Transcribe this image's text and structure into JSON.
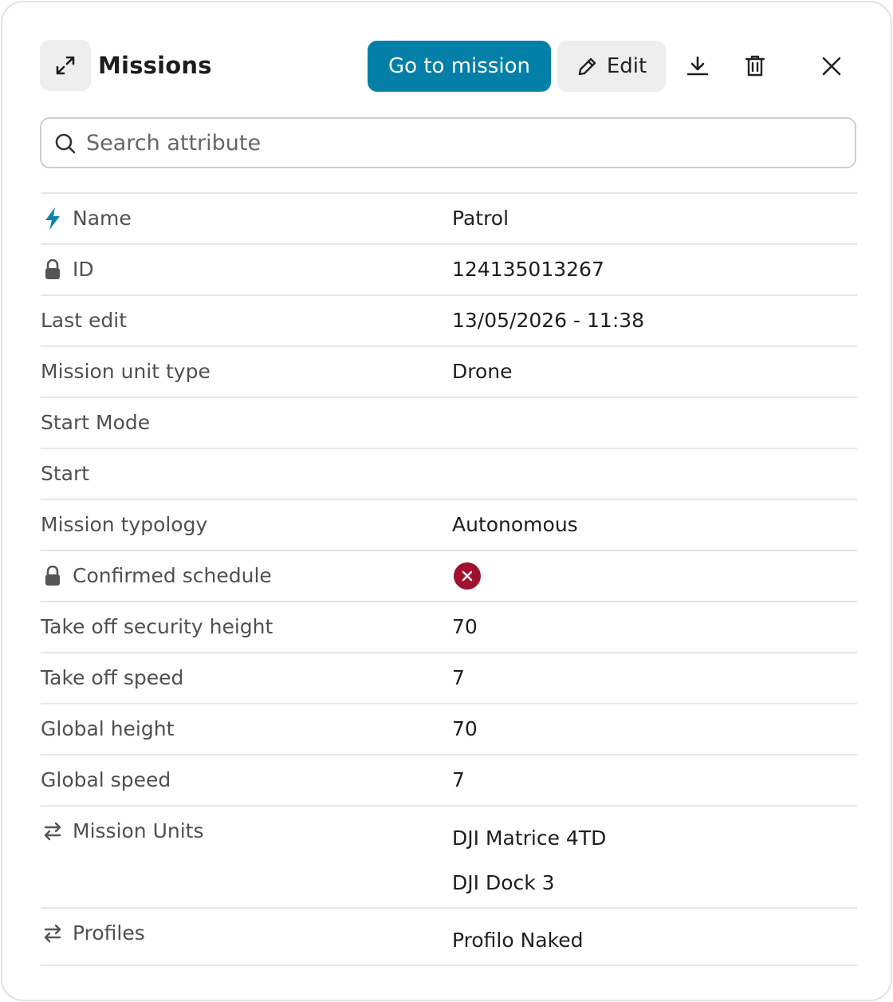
{
  "header": {
    "title": "Missions",
    "go_label": "Go to mission",
    "edit_label": "Edit"
  },
  "search": {
    "placeholder": "Search attribute"
  },
  "colors": {
    "accent": "#0480a8",
    "danger": "#a0102f",
    "border": "#e6e6e6"
  },
  "rows": {
    "name": {
      "label": "Name",
      "value": "Patrol",
      "icon": "bolt-icon"
    },
    "id": {
      "label": "ID",
      "value": "124135013267",
      "icon": "lock-icon"
    },
    "last_edit": {
      "label": "Last edit",
      "value": "13/05/2026 - 11:38"
    },
    "unit_type": {
      "label": "Mission unit type",
      "value": "Drone"
    },
    "start_mode": {
      "label": "Start Mode",
      "value": ""
    },
    "start": {
      "label": "Start",
      "value": ""
    },
    "typology": {
      "label": "Mission typology",
      "value": "Autonomous"
    },
    "confirmed_schedule": {
      "label": "Confirmed schedule",
      "icon": "lock-icon",
      "value_icon": "x-circle-icon"
    },
    "takeoff_height": {
      "label": "Take off security height",
      "value": "70"
    },
    "takeoff_speed": {
      "label": "Take off speed",
      "value": "7"
    },
    "global_height": {
      "label": "Global height",
      "value": "70"
    },
    "global_speed": {
      "label": "Global speed",
      "value": "7"
    },
    "mission_units": {
      "label": "Mission Units",
      "icon": "swap-arrows-icon",
      "values": [
        "DJI Matrice 4TD",
        "DJI Dock 3"
      ]
    },
    "profiles": {
      "label": "Profiles",
      "icon": "swap-arrows-icon",
      "values": [
        "Profilo Naked"
      ]
    }
  }
}
